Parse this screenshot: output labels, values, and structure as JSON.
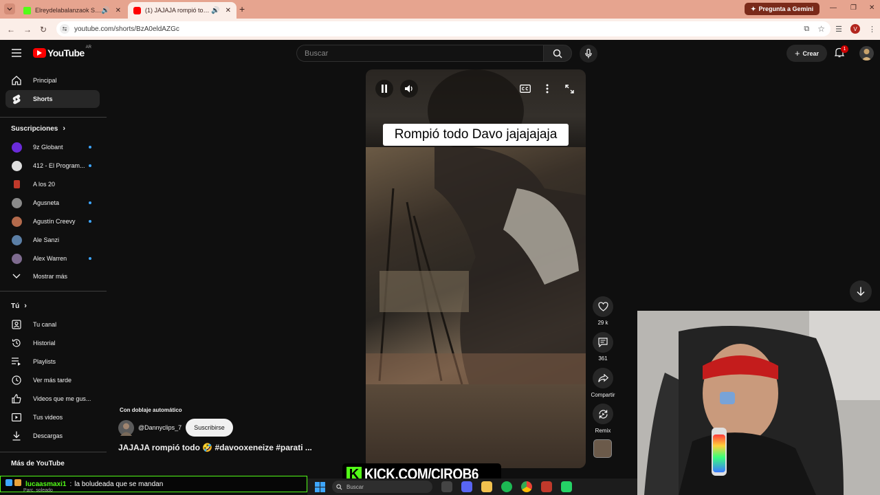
{
  "browser": {
    "tabs": [
      {
        "title": "Elreydelabalanzaok Stream",
        "color": "#53fc18",
        "audio": true,
        "active": false
      },
      {
        "title": "(1) JAJAJA rompió todo 🤣",
        "color": "#ff0000",
        "audio": true,
        "active": true
      }
    ],
    "gemini_label": "Pregunta a Gemini",
    "url": "youtube.com/shorts/BzA0eldAZGc",
    "profile_initial": "V"
  },
  "masthead": {
    "logo_text": "YouTube",
    "country_code": "AR",
    "search_placeholder": "Buscar",
    "create_label": "Crear",
    "notification_count": "1"
  },
  "sidebar": {
    "main": [
      {
        "label": "Principal",
        "icon": "home-icon",
        "active": false
      },
      {
        "label": "Shorts",
        "icon": "shorts-icon",
        "active": true
      }
    ],
    "subscriptions_header": "Suscripciones",
    "subscriptions": [
      {
        "label": "9z Globant",
        "color": "#6a2bd9",
        "new": true
      },
      {
        "label": "412 - El Program...",
        "color": "#dddddd",
        "new": true
      },
      {
        "label": "A los 20",
        "color": "#c0392b",
        "new": false
      },
      {
        "label": "Agusneta",
        "color": "#8a8a8a",
        "new": true
      },
      {
        "label": "Agustín Creevy",
        "color": "#b36a4c",
        "new": true
      },
      {
        "label": "Ale Sanzi",
        "color": "#5b7fa6",
        "new": false
      },
      {
        "label": "Alex Warren",
        "color": "#7e6b8f",
        "new": true
      }
    ],
    "show_more": "Mostrar más",
    "you_header": "Tú",
    "you_items": [
      {
        "label": "Tu canal",
        "icon": "channel-icon"
      },
      {
        "label": "Historial",
        "icon": "history-icon"
      },
      {
        "label": "Playlists",
        "icon": "playlists-icon"
      },
      {
        "label": "Ver más tarde",
        "icon": "watch-later-icon"
      },
      {
        "label": "Videos que me gus...",
        "icon": "liked-videos-icon"
      },
      {
        "label": "Tus videos",
        "icon": "your-videos-icon"
      },
      {
        "label": "Descargas",
        "icon": "downloads-icon"
      }
    ],
    "more_header": "Más de YouTube"
  },
  "short": {
    "caption": "Rompió todo Davo jajajajaja",
    "likes": "29 k",
    "comments": "361",
    "share_label": "Compartir",
    "remix_label": "Remix",
    "dub_label": "Con doblaje automático",
    "channel": "@Dannyclips_7",
    "subscribe_label": "Suscribirse",
    "title": "JAJAJA rompió todo 🤣 #davooxeneize #parati ..."
  },
  "overlay": {
    "kick_text": "KICK.COM/CIROB6",
    "chat_user": "lucaasmaxi1",
    "chat_separator": ":",
    "chat_message": "la boludeada que se mandan",
    "weather": "Parc. soleado",
    "taskbar_search": "Buscar"
  }
}
